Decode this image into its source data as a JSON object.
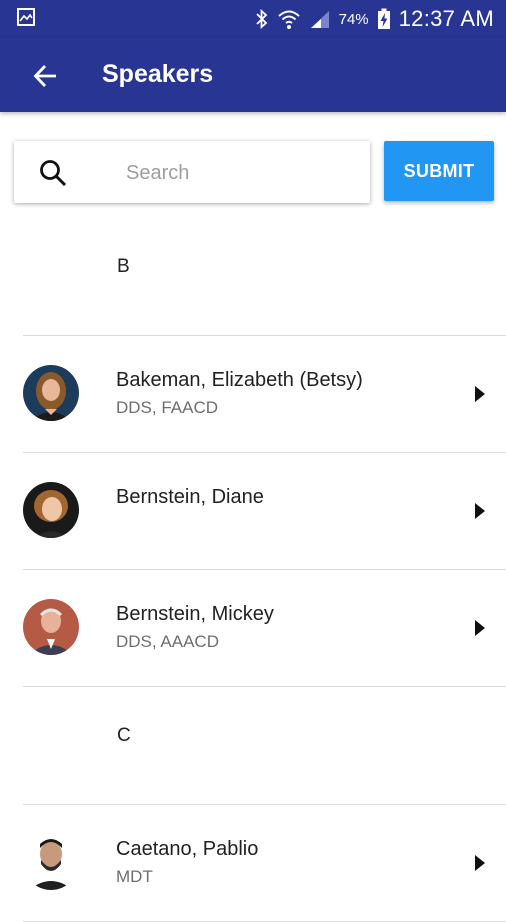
{
  "status_bar": {
    "battery_percent": "74%",
    "time": "12:37 AM"
  },
  "app_bar": {
    "title": "Speakers",
    "back_icon": "arrow-back-icon"
  },
  "search": {
    "placeholder": "Search",
    "value": "",
    "submit_label": "SUBMIT"
  },
  "sections": [
    {
      "letter": "B",
      "speakers": [
        {
          "name": "Bakeman, Elizabeth (Betsy)",
          "credentials": "DDS, FAACD"
        },
        {
          "name": "Bernstein, Diane",
          "credentials": ""
        },
        {
          "name": "Bernstein, Mickey",
          "credentials": "DDS, AAACD"
        }
      ]
    },
    {
      "letter": "C",
      "speakers": [
        {
          "name": "Caetano, Pablio",
          "credentials": "MDT"
        }
      ]
    }
  ],
  "colors": {
    "primary": "#283593",
    "accent": "#2196f3"
  }
}
